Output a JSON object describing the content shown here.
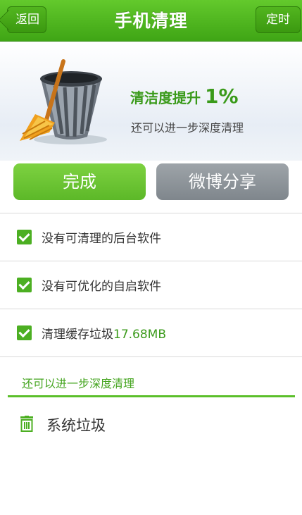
{
  "header": {
    "back_label": "返回",
    "title": "手机清理",
    "timer_label": "定时"
  },
  "hero": {
    "score_prefix": "清洁度提升",
    "score_value": "1%",
    "hint": "还可以进一步深度清理",
    "illustration_icon": "broom-trash-icon"
  },
  "actions": {
    "done_label": "完成",
    "share_label": "微博分享"
  },
  "results": [
    {
      "text": "没有可清理的后台软件",
      "size": ""
    },
    {
      "text": "没有可优化的自启软件",
      "size": ""
    },
    {
      "text": "清理缓存垃圾",
      "size": "17.68MB"
    }
  ],
  "deep_clean": {
    "section_title": "还可以进一步深度清理",
    "items": [
      {
        "label": "系统垃圾",
        "icon": "trash-icon"
      }
    ]
  },
  "colors": {
    "brand_green": "#4caf22",
    "share_gray": "#8a9095",
    "accent_text": "#3a9a1a"
  }
}
